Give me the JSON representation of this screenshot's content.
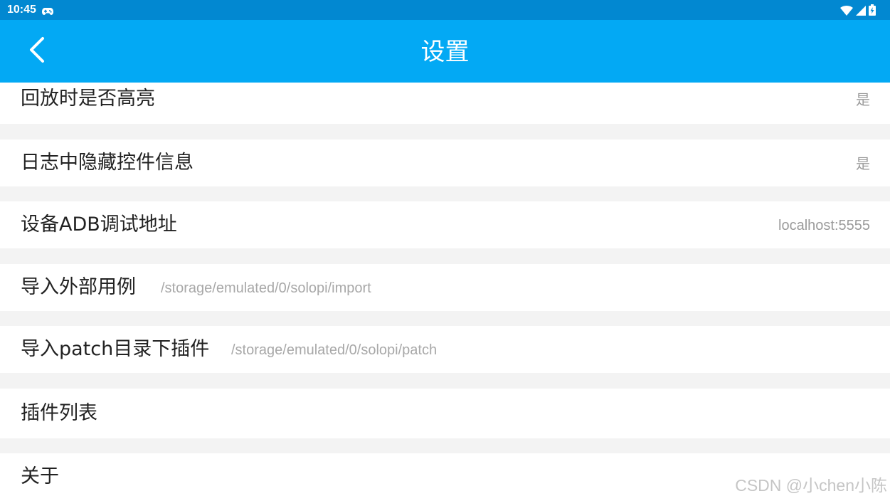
{
  "status_bar": {
    "time": "10:45",
    "icons": [
      "gamepad-icon",
      "wifi-icon",
      "signal-icon",
      "battery-charging-icon"
    ]
  },
  "app_bar": {
    "title": "设置",
    "back_icon": "chevron-left-icon"
  },
  "settings": [
    {
      "label": "回放时是否高亮",
      "value": "是"
    },
    {
      "label": "日志中隐藏控件信息",
      "value": "是"
    },
    {
      "label": "设备ADB调试地址",
      "value": "localhost:5555"
    },
    {
      "label": "导入外部用例",
      "path": "/storage/emulated/0/solopi/import"
    },
    {
      "label": "导入patch目录下插件",
      "path": "/storage/emulated/0/solopi/patch"
    },
    {
      "label": "插件列表"
    },
    {
      "label": "关于"
    }
  ],
  "watermark": "CSDN @小chen小陈",
  "colors": {
    "status_bar": "#0288d1",
    "app_bar": "#03a9f4",
    "background": "#f3f3f3",
    "row": "#ffffff",
    "secondary_text": "#9b9b9b"
  }
}
